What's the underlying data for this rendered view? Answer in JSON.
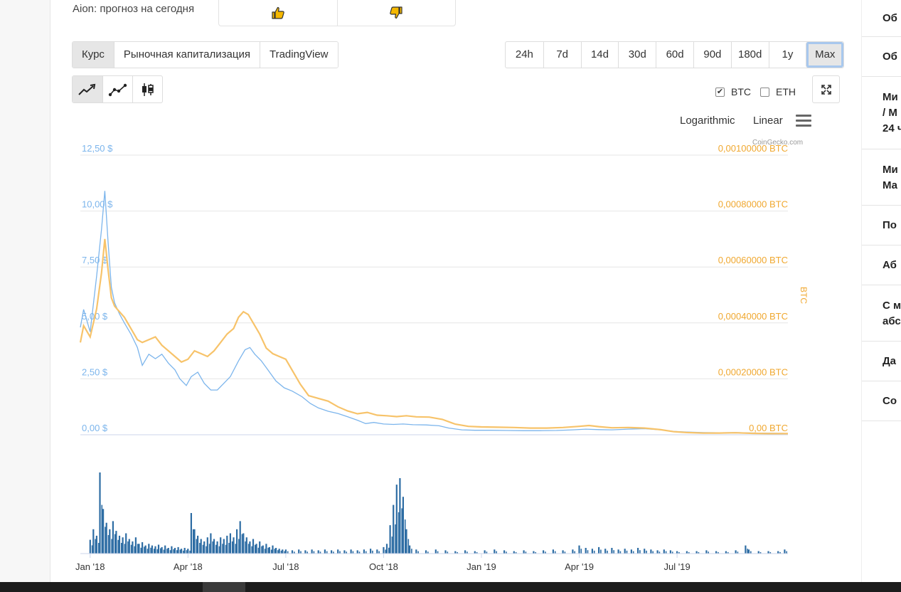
{
  "vote": {
    "label": "Aion: прогноз на сегодня",
    "up_icon": "thumbs-up-icon",
    "down_icon": "thumbs-down-icon",
    "icon_color": "#f5b800"
  },
  "tabs": [
    {
      "label": "Курс",
      "active": true
    },
    {
      "label": "Рыночная капитализация",
      "active": false
    },
    {
      "label": "TradingView",
      "active": false
    }
  ],
  "ranges": [
    {
      "label": "24h"
    },
    {
      "label": "7d"
    },
    {
      "label": "14d"
    },
    {
      "label": "30d"
    },
    {
      "label": "60d"
    },
    {
      "label": "90d"
    },
    {
      "label": "180d"
    },
    {
      "label": "1y"
    },
    {
      "label": "Max",
      "active": true
    }
  ],
  "chart_types": [
    {
      "icon": "line-chart-icon",
      "active": true
    },
    {
      "icon": "line-markers-chart-icon",
      "active": false
    },
    {
      "icon": "candlestick-chart-icon",
      "active": false
    }
  ],
  "compare": [
    {
      "label": "BTC",
      "checked": true
    },
    {
      "label": "ETH",
      "checked": false
    }
  ],
  "scale": {
    "log_label": "Logarithmic",
    "linear_label": "Linear"
  },
  "credit": "CoinGecko.com",
  "right_panel": {
    "rows": [
      "Об",
      "Об",
      "Ми\n/ М\n24 ч",
      "Ми\nМа",
      "По",
      "Аб",
      "С м\nабс",
      "Да",
      "Со"
    ]
  },
  "chart_data": {
    "type": "line",
    "colors": {
      "usd": "#7cb5ec",
      "btc": "#f7c36a",
      "btc_axis": "#f0a830",
      "volume": "#2e6da4",
      "grid": "#e6e6e6"
    },
    "x_ticks": [
      "Jan '18",
      "Apr '18",
      "Jul '18",
      "Oct '18",
      "Jan '19",
      "Apr '19",
      "Jul '19"
    ],
    "x_tick_months": [
      0,
      3,
      6,
      9,
      12,
      15,
      18
    ],
    "x_range_months": [
      -0.3,
      21.4
    ],
    "y_left": {
      "ticks": [
        "0,00 $",
        "2,50 $",
        "5,00 $",
        "7,50 $",
        "10,00 $",
        "12,50 $"
      ],
      "min": 0,
      "max": 12.5
    },
    "y_right": {
      "label": "BTC",
      "ticks": [
        "0,00 BTC",
        "0,00020000 BTC",
        "0,00040000 BTC",
        "0,00060000 BTC",
        "0,00080000 BTC",
        "0,00100000 BTC"
      ],
      "min": 0,
      "max": 0.001
    },
    "series": [
      {
        "name": "USD",
        "axis": "left",
        "points": [
          [
            -0.3,
            4.8
          ],
          [
            -0.2,
            5.6
          ],
          [
            0,
            4.6
          ],
          [
            0.2,
            7.1
          ],
          [
            0.35,
            9.2
          ],
          [
            0.45,
            10.9
          ],
          [
            0.55,
            8.6
          ],
          [
            0.65,
            6.6
          ],
          [
            0.75,
            5.9
          ],
          [
            0.9,
            5.4
          ],
          [
            1.05,
            5.0
          ],
          [
            1.25,
            4.5
          ],
          [
            1.45,
            3.9
          ],
          [
            1.6,
            3.1
          ],
          [
            1.8,
            3.6
          ],
          [
            2.0,
            3.4
          ],
          [
            2.2,
            3.6
          ],
          [
            2.4,
            3.2
          ],
          [
            2.6,
            2.9
          ],
          [
            2.75,
            2.5
          ],
          [
            2.95,
            2.2
          ],
          [
            3.1,
            2.6
          ],
          [
            3.3,
            2.8
          ],
          [
            3.5,
            2.3
          ],
          [
            3.7,
            2.0
          ],
          [
            3.9,
            2.0
          ],
          [
            4.1,
            2.3
          ],
          [
            4.3,
            2.6
          ],
          [
            4.55,
            3.3
          ],
          [
            4.75,
            3.8
          ],
          [
            4.9,
            3.9
          ],
          [
            5.05,
            3.6
          ],
          [
            5.25,
            3.3
          ],
          [
            5.45,
            2.9
          ],
          [
            5.7,
            2.4
          ],
          [
            5.95,
            2.1
          ],
          [
            6.2,
            1.95
          ],
          [
            6.5,
            1.7
          ],
          [
            6.75,
            1.4
          ],
          [
            7.0,
            1.2
          ],
          [
            7.3,
            1.05
          ],
          [
            7.6,
            0.95
          ],
          [
            7.9,
            0.8
          ],
          [
            8.2,
            0.65
          ],
          [
            8.45,
            0.5
          ],
          [
            8.7,
            0.55
          ],
          [
            9.0,
            0.48
          ],
          [
            9.3,
            0.46
          ],
          [
            9.6,
            0.48
          ],
          [
            9.9,
            0.45
          ],
          [
            10.3,
            0.44
          ],
          [
            10.7,
            0.4
          ],
          [
            11.0,
            0.3
          ],
          [
            11.4,
            0.22
          ],
          [
            11.8,
            0.2
          ],
          [
            12.3,
            0.2
          ],
          [
            12.8,
            0.19
          ],
          [
            13.3,
            0.18
          ],
          [
            13.8,
            0.18
          ],
          [
            14.3,
            0.19
          ],
          [
            14.8,
            0.22
          ],
          [
            15.2,
            0.25
          ],
          [
            15.6,
            0.23
          ],
          [
            16.0,
            0.22
          ],
          [
            16.5,
            0.25
          ],
          [
            17.0,
            0.27
          ],
          [
            17.5,
            0.22
          ],
          [
            17.9,
            0.15
          ],
          [
            18.3,
            0.12
          ],
          [
            18.8,
            0.1
          ],
          [
            19.3,
            0.09
          ],
          [
            19.8,
            0.1
          ],
          [
            20.3,
            0.08
          ],
          [
            20.8,
            0.07
          ],
          [
            21.4,
            0.06
          ]
        ]
      },
      {
        "name": "BTC",
        "axis": "right",
        "points": [
          [
            -0.3,
            0.00033
          ],
          [
            -0.2,
            0.00039
          ],
          [
            0,
            0.00035
          ],
          [
            0.2,
            0.00045
          ],
          [
            0.35,
            0.00058
          ],
          [
            0.45,
            0.0007
          ],
          [
            0.55,
            0.00059
          ],
          [
            0.65,
            0.00049
          ],
          [
            0.75,
            0.00046
          ],
          [
            0.9,
            0.00044
          ],
          [
            1.05,
            0.00042
          ],
          [
            1.25,
            0.00038
          ],
          [
            1.45,
            0.00034
          ],
          [
            1.6,
            0.00033
          ],
          [
            1.8,
            0.00034
          ],
          [
            2.0,
            0.00035
          ],
          [
            2.2,
            0.00032
          ],
          [
            2.4,
            0.0003
          ],
          [
            2.6,
            0.00028
          ],
          [
            2.8,
            0.00026
          ],
          [
            3.0,
            0.00027
          ],
          [
            3.2,
            0.0003
          ],
          [
            3.4,
            0.00029
          ],
          [
            3.6,
            0.00028
          ],
          [
            3.8,
            0.0003
          ],
          [
            4.0,
            0.00033
          ],
          [
            4.2,
            0.00036
          ],
          [
            4.4,
            0.00038
          ],
          [
            4.55,
            0.00042
          ],
          [
            4.7,
            0.00044
          ],
          [
            4.85,
            0.00043
          ],
          [
            5.0,
            0.0004
          ],
          [
            5.2,
            0.00036
          ],
          [
            5.4,
            0.00031
          ],
          [
            5.6,
            0.00029
          ],
          [
            5.8,
            0.00028
          ],
          [
            6.0,
            0.00027
          ],
          [
            6.2,
            0.00023
          ],
          [
            6.45,
            0.00018
          ],
          [
            6.7,
            0.00014
          ],
          [
            7.0,
            0.00013
          ],
          [
            7.3,
            0.00012
          ],
          [
            7.6,
            0.0001
          ],
          [
            7.9,
            8.5e-05
          ],
          [
            8.2,
            7.5e-05
          ],
          [
            8.5,
            8e-05
          ],
          [
            8.8,
            7e-05
          ],
          [
            9.1,
            6.8e-05
          ],
          [
            9.4,
            6.5e-05
          ],
          [
            9.7,
            6.8e-05
          ],
          [
            10.0,
            6.4e-05
          ],
          [
            10.4,
            6.3e-05
          ],
          [
            10.8,
            5.5e-05
          ],
          [
            11.2,
            3.8e-05
          ],
          [
            11.6,
            3e-05
          ],
          [
            12.0,
            2.8e-05
          ],
          [
            12.5,
            2.7e-05
          ],
          [
            13.0,
            2.6e-05
          ],
          [
            13.5,
            2.4e-05
          ],
          [
            14.0,
            2.4e-05
          ],
          [
            14.5,
            2.6e-05
          ],
          [
            15.0,
            3e-05
          ],
          [
            15.3,
            3.3e-05
          ],
          [
            15.6,
            2.9e-05
          ],
          [
            16.0,
            2.5e-05
          ],
          [
            16.5,
            2.6e-05
          ],
          [
            17.0,
            2.4e-05
          ],
          [
            17.5,
            1.8e-05
          ],
          [
            17.9,
            1.1e-05
          ],
          [
            18.3,
            8e-06
          ],
          [
            18.8,
            6e-06
          ],
          [
            19.3,
            6e-06
          ],
          [
            19.8,
            7e-06
          ],
          [
            20.3,
            5e-06
          ],
          [
            20.8,
            4e-06
          ],
          [
            21.4,
            4e-06
          ]
        ]
      }
    ],
    "volume_level_hint": "relative 0-1",
    "volume": [
      [
        0.0,
        0.17
      ],
      [
        0.1,
        0.3
      ],
      [
        0.2,
        0.22
      ],
      [
        0.3,
        1.0
      ],
      [
        0.4,
        0.55
      ],
      [
        0.5,
        0.38
      ],
      [
        0.6,
        0.3
      ],
      [
        0.7,
        0.4
      ],
      [
        0.8,
        0.28
      ],
      [
        0.9,
        0.22
      ],
      [
        1.0,
        0.2
      ],
      [
        1.1,
        0.25
      ],
      [
        1.2,
        0.18
      ],
      [
        1.3,
        0.15
      ],
      [
        1.4,
        0.2
      ],
      [
        1.5,
        0.12
      ],
      [
        1.6,
        0.14
      ],
      [
        1.7,
        0.1
      ],
      [
        1.8,
        0.12
      ],
      [
        1.9,
        0.1
      ],
      [
        2.0,
        0.09
      ],
      [
        2.1,
        0.11
      ],
      [
        2.2,
        0.08
      ],
      [
        2.3,
        0.1
      ],
      [
        2.4,
        0.07
      ],
      [
        2.5,
        0.09
      ],
      [
        2.6,
        0.07
      ],
      [
        2.7,
        0.08
      ],
      [
        2.8,
        0.06
      ],
      [
        2.9,
        0.07
      ],
      [
        3.0,
        0.06
      ],
      [
        3.1,
        0.5
      ],
      [
        3.2,
        0.3
      ],
      [
        3.3,
        0.22
      ],
      [
        3.4,
        0.18
      ],
      [
        3.5,
        0.15
      ],
      [
        3.6,
        0.2
      ],
      [
        3.7,
        0.25
      ],
      [
        3.8,
        0.18
      ],
      [
        3.9,
        0.15
      ],
      [
        4.0,
        0.2
      ],
      [
        4.1,
        0.18
      ],
      [
        4.2,
        0.22
      ],
      [
        4.3,
        0.25
      ],
      [
        4.4,
        0.2
      ],
      [
        4.5,
        0.3
      ],
      [
        4.6,
        0.4
      ],
      [
        4.7,
        0.25
      ],
      [
        4.8,
        0.2
      ],
      [
        4.9,
        0.15
      ],
      [
        5.0,
        0.18
      ],
      [
        5.1,
        0.12
      ],
      [
        5.2,
        0.15
      ],
      [
        5.3,
        0.1
      ],
      [
        5.4,
        0.12
      ],
      [
        5.5,
        0.08
      ],
      [
        5.6,
        0.1
      ],
      [
        5.7,
        0.07
      ],
      [
        5.8,
        0.06
      ],
      [
        5.9,
        0.05
      ],
      [
        6.0,
        0.05
      ],
      [
        6.2,
        0.04
      ],
      [
        6.4,
        0.05
      ],
      [
        6.6,
        0.04
      ],
      [
        6.8,
        0.05
      ],
      [
        7.0,
        0.04
      ],
      [
        7.2,
        0.05
      ],
      [
        7.4,
        0.04
      ],
      [
        7.6,
        0.05
      ],
      [
        7.8,
        0.04
      ],
      [
        8.0,
        0.05
      ],
      [
        8.2,
        0.04
      ],
      [
        8.4,
        0.05
      ],
      [
        8.6,
        0.06
      ],
      [
        8.8,
        0.05
      ],
      [
        9.0,
        0.08
      ],
      [
        9.1,
        0.12
      ],
      [
        9.2,
        0.35
      ],
      [
        9.3,
        0.6
      ],
      [
        9.4,
        0.85
      ],
      [
        9.5,
        0.93
      ],
      [
        9.6,
        0.7
      ],
      [
        9.7,
        0.3
      ],
      [
        9.8,
        0.1
      ],
      [
        10.0,
        0.05
      ],
      [
        10.3,
        0.04
      ],
      [
        10.6,
        0.05
      ],
      [
        10.9,
        0.04
      ],
      [
        11.2,
        0.03
      ],
      [
        11.5,
        0.04
      ],
      [
        11.8,
        0.03
      ],
      [
        12.1,
        0.04
      ],
      [
        12.4,
        0.05
      ],
      [
        12.7,
        0.04
      ],
      [
        13.0,
        0.03
      ],
      [
        13.3,
        0.04
      ],
      [
        13.6,
        0.03
      ],
      [
        13.9,
        0.04
      ],
      [
        14.2,
        0.05
      ],
      [
        14.5,
        0.04
      ],
      [
        14.8,
        0.05
      ],
      [
        15.0,
        0.1
      ],
      [
        15.2,
        0.07
      ],
      [
        15.4,
        0.06
      ],
      [
        15.6,
        0.08
      ],
      [
        15.8,
        0.06
      ],
      [
        16.0,
        0.07
      ],
      [
        16.2,
        0.05
      ],
      [
        16.4,
        0.06
      ],
      [
        16.6,
        0.05
      ],
      [
        16.8,
        0.07
      ],
      [
        17.0,
        0.06
      ],
      [
        17.2,
        0.05
      ],
      [
        17.4,
        0.04
      ],
      [
        17.6,
        0.05
      ],
      [
        17.8,
        0.04
      ],
      [
        18.0,
        0.03
      ],
      [
        18.3,
        0.03
      ],
      [
        18.6,
        0.03
      ],
      [
        18.9,
        0.04
      ],
      [
        19.2,
        0.03
      ],
      [
        19.5,
        0.03
      ],
      [
        19.8,
        0.04
      ],
      [
        20.1,
        0.1
      ],
      [
        20.2,
        0.05
      ],
      [
        20.5,
        0.03
      ],
      [
        20.8,
        0.03
      ],
      [
        21.1,
        0.03
      ],
      [
        21.3,
        0.05
      ]
    ]
  }
}
